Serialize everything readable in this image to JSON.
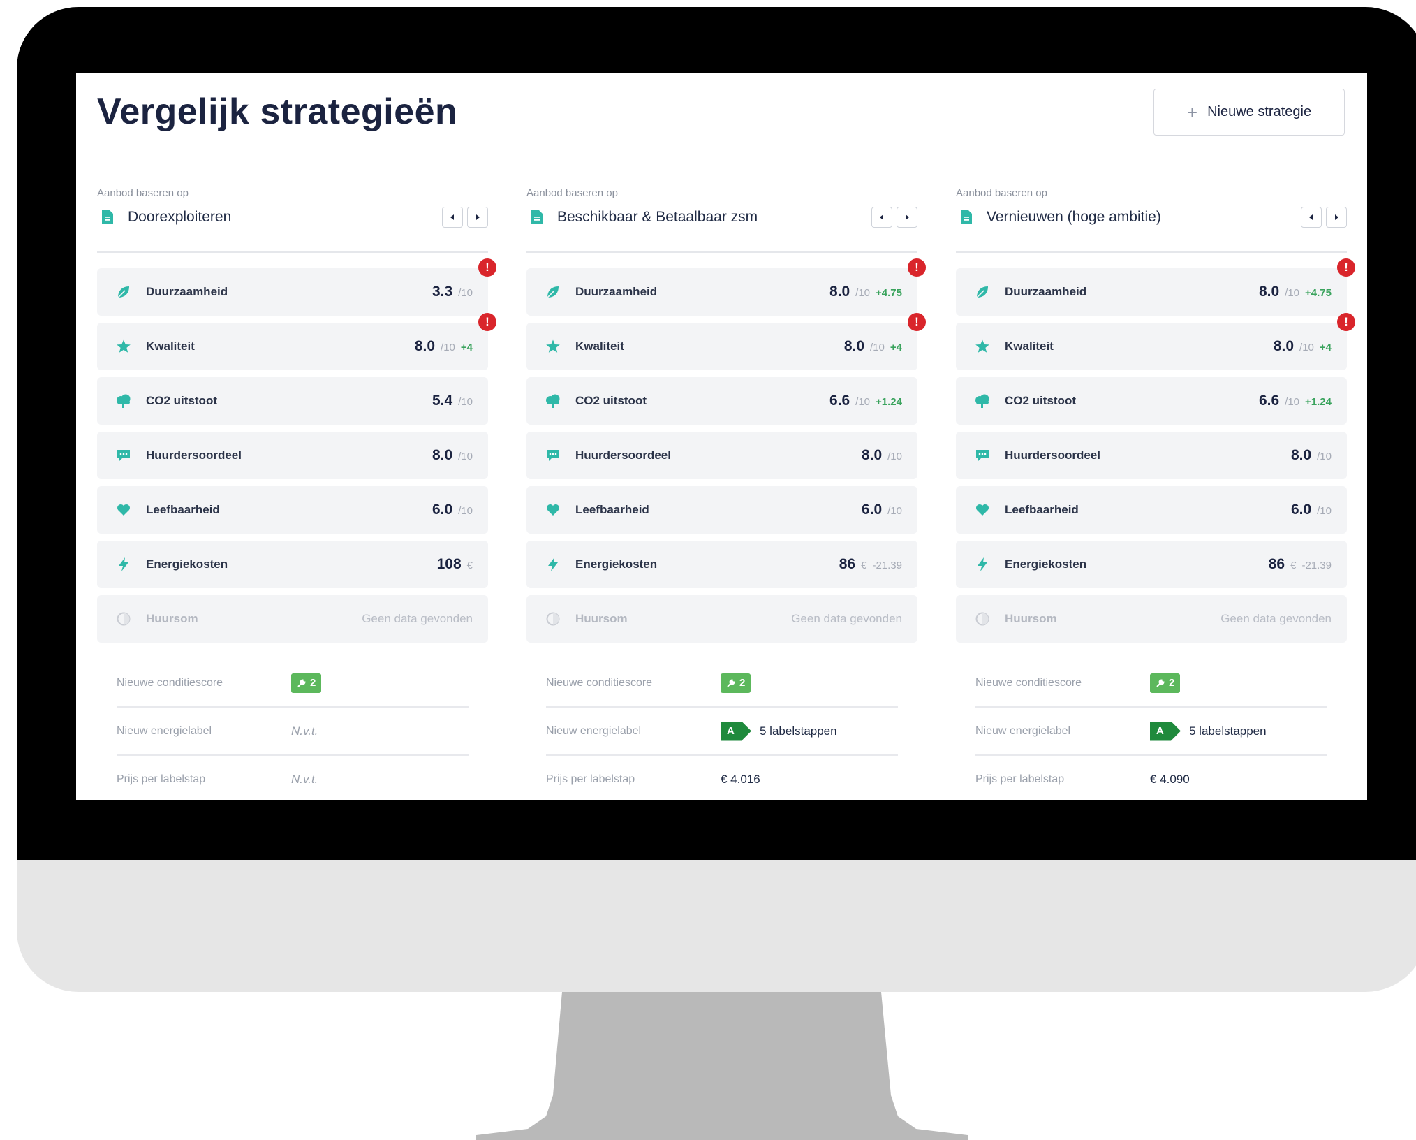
{
  "page": {
    "title": "Vergelijk strategieën",
    "new_strategy_button": "Nieuwe strategie"
  },
  "colors": {
    "accent_teal": "#2fb8a8",
    "title_navy": "#1b2340",
    "positive_green": "#3aa35d",
    "alert_red": "#d9252b",
    "label_green": "#1f8a3c",
    "condition_green": "#5cb85c"
  },
  "columns": [
    {
      "basis_label": "Aanbod baseren op",
      "strategy": "Doorexploiteren",
      "metrics": [
        {
          "label": "Duurzaamheid",
          "icon": "leaf-icon",
          "value": "3.3",
          "unit": "/10",
          "delta": "",
          "alert": "!"
        },
        {
          "label": "Kwaliteit",
          "icon": "star-icon",
          "value": "8.0",
          "unit": "/10",
          "delta": "+4",
          "alert": "!"
        },
        {
          "label": "CO2 uitstoot",
          "icon": "cloud-icon",
          "value": "5.4",
          "unit": "/10",
          "delta": "",
          "alert": ""
        },
        {
          "label": "Huurdersoordeel",
          "icon": "chat-icon",
          "value": "8.0",
          "unit": "/10",
          "delta": "",
          "alert": ""
        },
        {
          "label": "Leefbaarheid",
          "icon": "heart-icon",
          "value": "6.0",
          "unit": "/10",
          "delta": "",
          "alert": ""
        },
        {
          "label": "Energiekosten",
          "icon": "lightning-icon",
          "value": "108",
          "unit": "€",
          "delta": "",
          "alert": ""
        }
      ],
      "huursom": {
        "label": "Huursom",
        "nodata": "Geen data gevonden"
      },
      "details": {
        "condition_label": "Nieuwe conditiescore",
        "condition_value": "2",
        "energy_label_label": "Nieuw energielabel",
        "energy_label_letter": "",
        "energy_label_value": "N.v.t.",
        "price_label": "Prijs per labelstap",
        "price_value": "N.v.t."
      }
    },
    {
      "basis_label": "Aanbod baseren op",
      "strategy": "Beschikbaar & Betaalbaar zsm",
      "metrics": [
        {
          "label": "Duurzaamheid",
          "icon": "leaf-icon",
          "value": "8.0",
          "unit": "/10",
          "delta": "+4.75",
          "alert": "!"
        },
        {
          "label": "Kwaliteit",
          "icon": "star-icon",
          "value": "8.0",
          "unit": "/10",
          "delta": "+4",
          "alert": "!"
        },
        {
          "label": "CO2 uitstoot",
          "icon": "cloud-icon",
          "value": "6.6",
          "unit": "/10",
          "delta": "+1.24",
          "alert": ""
        },
        {
          "label": "Huurdersoordeel",
          "icon": "chat-icon",
          "value": "8.0",
          "unit": "/10",
          "delta": "",
          "alert": ""
        },
        {
          "label": "Leefbaarheid",
          "icon": "heart-icon",
          "value": "6.0",
          "unit": "/10",
          "delta": "",
          "alert": ""
        },
        {
          "label": "Energiekosten",
          "icon": "lightning-icon",
          "value": "86",
          "unit": "€",
          "delta": "-21.39",
          "alert": ""
        }
      ],
      "huursom": {
        "label": "Huursom",
        "nodata": "Geen data gevonden"
      },
      "details": {
        "condition_label": "Nieuwe conditiescore",
        "condition_value": "2",
        "energy_label_label": "Nieuw energielabel",
        "energy_label_letter": "A",
        "energy_label_value": "5 labelstappen",
        "price_label": "Prijs per labelstap",
        "price_value": "€ 4.016"
      }
    },
    {
      "basis_label": "Aanbod baseren op",
      "strategy": "Vernieuwen (hoge ambitie)",
      "metrics": [
        {
          "label": "Duurzaamheid",
          "icon": "leaf-icon",
          "value": "8.0",
          "unit": "/10",
          "delta": "+4.75",
          "alert": "!"
        },
        {
          "label": "Kwaliteit",
          "icon": "star-icon",
          "value": "8.0",
          "unit": "/10",
          "delta": "+4",
          "alert": "!"
        },
        {
          "label": "CO2 uitstoot",
          "icon": "cloud-icon",
          "value": "6.6",
          "unit": "/10",
          "delta": "+1.24",
          "alert": ""
        },
        {
          "label": "Huurdersoordeel",
          "icon": "chat-icon",
          "value": "8.0",
          "unit": "/10",
          "delta": "",
          "alert": ""
        },
        {
          "label": "Leefbaarheid",
          "icon": "heart-icon",
          "value": "6.0",
          "unit": "/10",
          "delta": "",
          "alert": ""
        },
        {
          "label": "Energiekosten",
          "icon": "lightning-icon",
          "value": "86",
          "unit": "€",
          "delta": "-21.39",
          "alert": ""
        }
      ],
      "huursom": {
        "label": "Huursom",
        "nodata": "Geen data gevonden"
      },
      "details": {
        "condition_label": "Nieuwe conditiescore",
        "condition_value": "2",
        "energy_label_label": "Nieuw energielabel",
        "energy_label_letter": "A",
        "energy_label_value": "5 labelstappen",
        "price_label": "Prijs per labelstap",
        "price_value": "€ 4.090"
      }
    }
  ]
}
